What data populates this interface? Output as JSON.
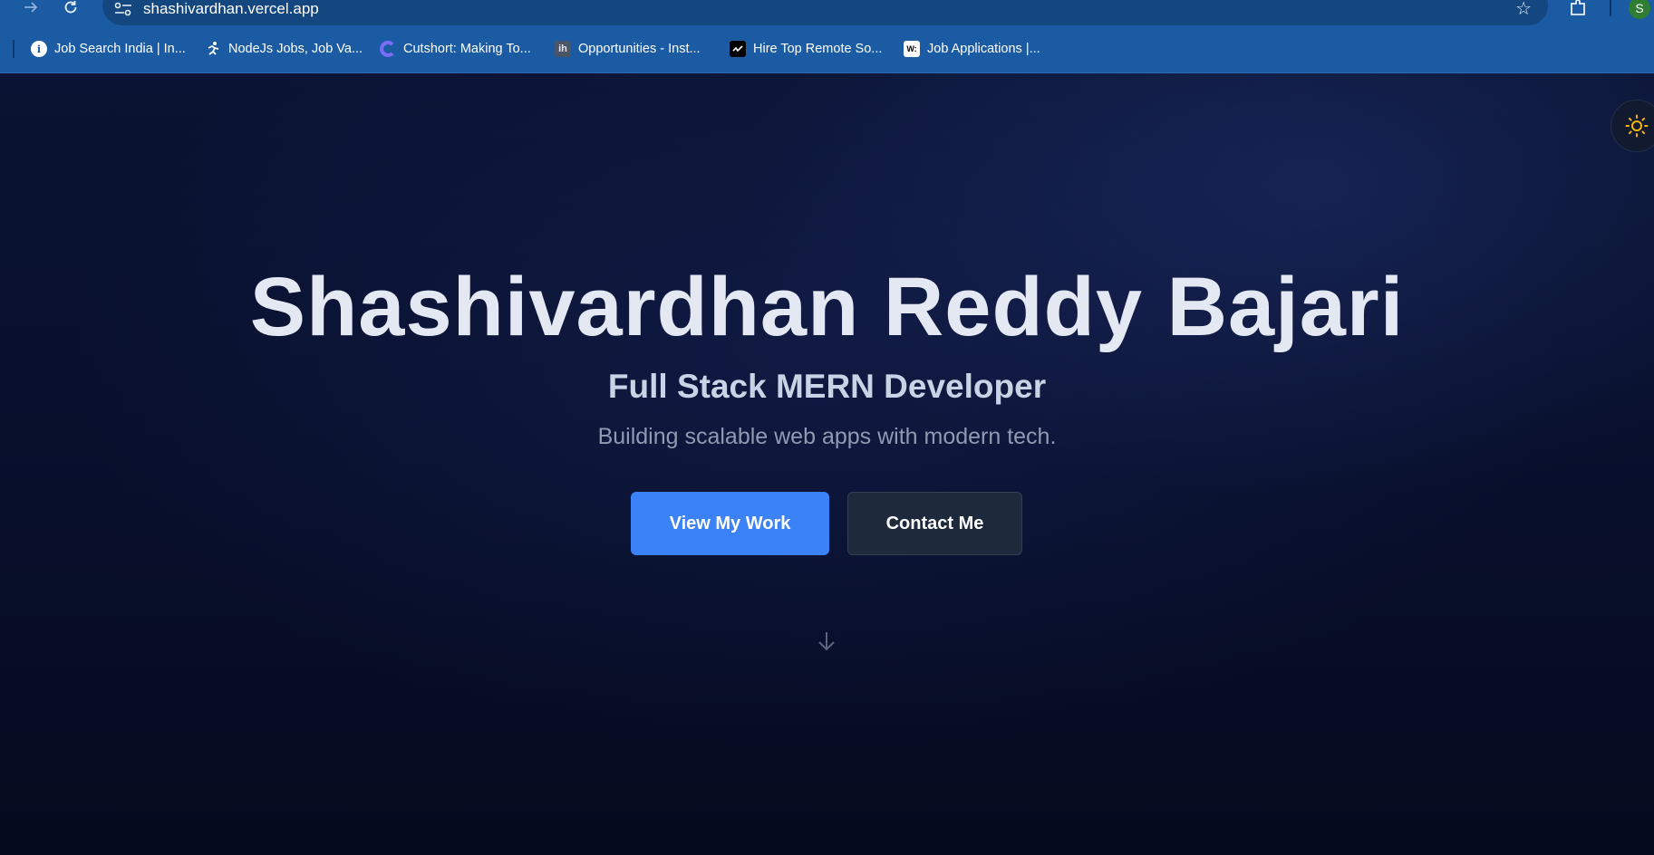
{
  "browser": {
    "url": "shashivardhan.vercel.app",
    "profile_initial": "S",
    "bookmarks": [
      {
        "label": "Job Search India | In...",
        "icon": "info-icon"
      },
      {
        "label": "NodeJs Jobs, Job Va...",
        "icon": "runner-icon"
      },
      {
        "label": "Cutshort: Making To...",
        "icon": "cutshort-logo-icon"
      },
      {
        "label": "Opportunities - Inst...",
        "icon": "ih-logo-icon",
        "icon_text": "ih"
      },
      {
        "label": "Hire Top Remote So...",
        "icon": "remote-logo-icon"
      },
      {
        "label": "Job Applications |...",
        "icon": "wellfound-logo-icon",
        "icon_text": "W:"
      }
    ]
  },
  "hero": {
    "name": "Shashivardhan Reddy Bajari",
    "role": "Full Stack MERN Developer",
    "tagline": "Building scalable web apps with modern tech.",
    "primary_button": "View My Work",
    "secondary_button": "Contact Me"
  },
  "colors": {
    "chrome_bg": "#1b5ba3",
    "page_bg": "#070d24",
    "primary_button": "#3b82f6",
    "secondary_button": "#1e293b",
    "sun_icon": "#f5b50a"
  }
}
